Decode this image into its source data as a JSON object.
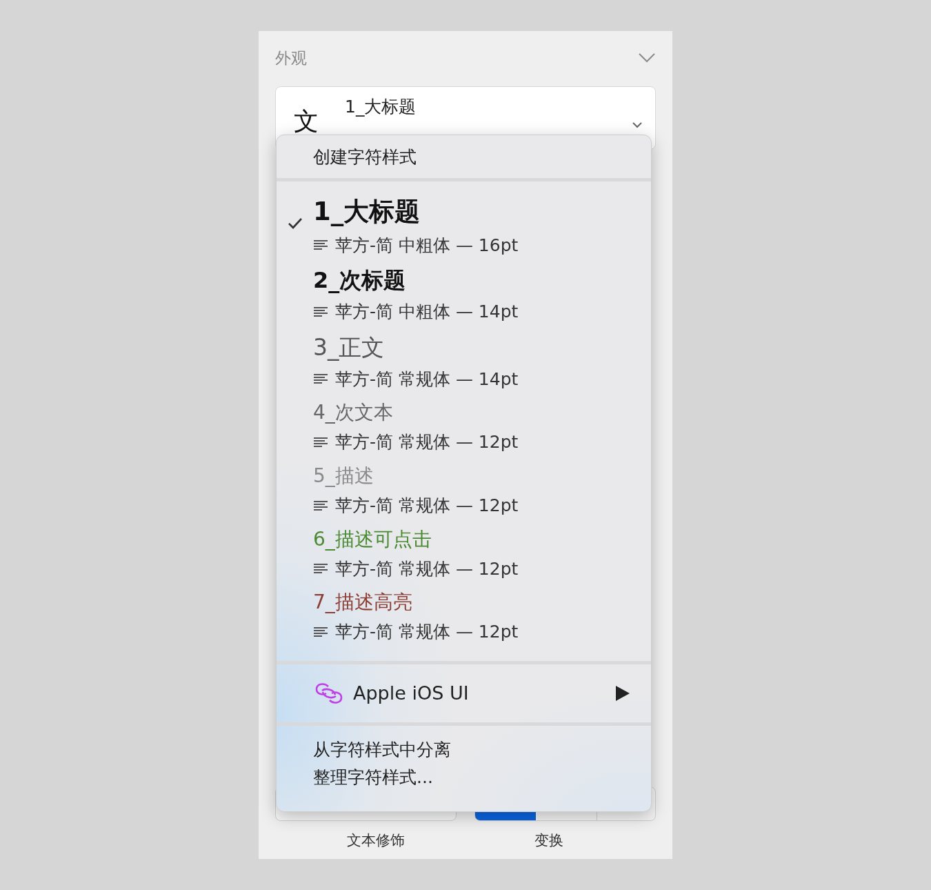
{
  "section": {
    "title": "外观",
    "expanded": true
  },
  "style_field": {
    "icon": "文",
    "value": "1_大标题"
  },
  "menu": {
    "create": "创建字符样式",
    "styles": [
      {
        "name": "1_大标题",
        "detail": "苹方-简 中粗体 — 16pt",
        "selected": true,
        "kind": "h1",
        "color": "#111111"
      },
      {
        "name": "2_次标题",
        "detail": "苹方-简 中粗体 — 14pt",
        "selected": false,
        "kind": "h2",
        "color": "#111111"
      },
      {
        "name": "3_正文",
        "detail": "苹方-简 常规体 — 14pt",
        "selected": false,
        "kind": "body",
        "color": "#555555"
      },
      {
        "name": "4_次文本",
        "detail": "苹方-简 常规体 — 12pt",
        "selected": false,
        "kind": "small",
        "color": "#666666"
      },
      {
        "name": "5_描述",
        "detail": "苹方-简 常规体 — 12pt",
        "selected": false,
        "kind": "small",
        "color": "#8a8a8a"
      },
      {
        "name": "6_描述可点击",
        "detail": "苹方-简 常规体 — 12pt",
        "selected": false,
        "kind": "small",
        "color": "#4b8a33"
      },
      {
        "name": "7_描述高亮",
        "detail": "苹方-简 常规体 — 12pt",
        "selected": false,
        "kind": "small",
        "color": "#8c3e35"
      }
    ],
    "library": {
      "label": "Apple iOS UI"
    },
    "actions": [
      "从字符样式中分离",
      "整理字符样式..."
    ]
  },
  "bottom_labels": [
    "文本修饰",
    "变换"
  ]
}
